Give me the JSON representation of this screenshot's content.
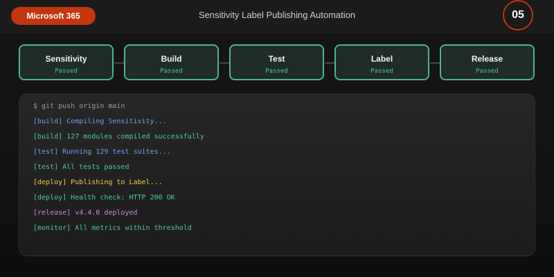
{
  "header": {
    "brand": "Microsoft 365",
    "title": "Sensitivity Label Publishing Automation",
    "step_number": "05"
  },
  "pipeline": {
    "stages": [
      {
        "name": "Sensitivity",
        "status": "Passed"
      },
      {
        "name": "Build",
        "status": "Passed"
      },
      {
        "name": "Test",
        "status": "Passed"
      },
      {
        "name": "Label",
        "status": "Passed"
      },
      {
        "name": "Release",
        "status": "Passed"
      }
    ]
  },
  "terminal": {
    "lines": [
      {
        "text": "$ git push origin main",
        "color": "#9a9a9a"
      },
      {
        "text": "[build] Compiling Sensitivity...",
        "color": "#6aa2f0"
      },
      {
        "text": "[build] 127 modules compiled successfully",
        "color": "#4fc79d"
      },
      {
        "text": "[test] Running 129 test suites...",
        "color": "#6aa2f0"
      },
      {
        "text": "[test] All tests passed",
        "color": "#4fc79d"
      },
      {
        "text": "[deploy] Publishing to Label...",
        "color": "#f2c94c"
      },
      {
        "text": "[deploy] Health check: HTTP 200 OK",
        "color": "#4fc79d"
      },
      {
        "text": "[release] v4.4.0 deployed",
        "color": "#c58ad6"
      },
      {
        "text": "[monitor] All metrics within threshold",
        "color": "#4fc79d"
      }
    ]
  },
  "colors": {
    "accent": "#c3360e",
    "stage_border": "#4fb392",
    "passed": "#4fc79d"
  }
}
